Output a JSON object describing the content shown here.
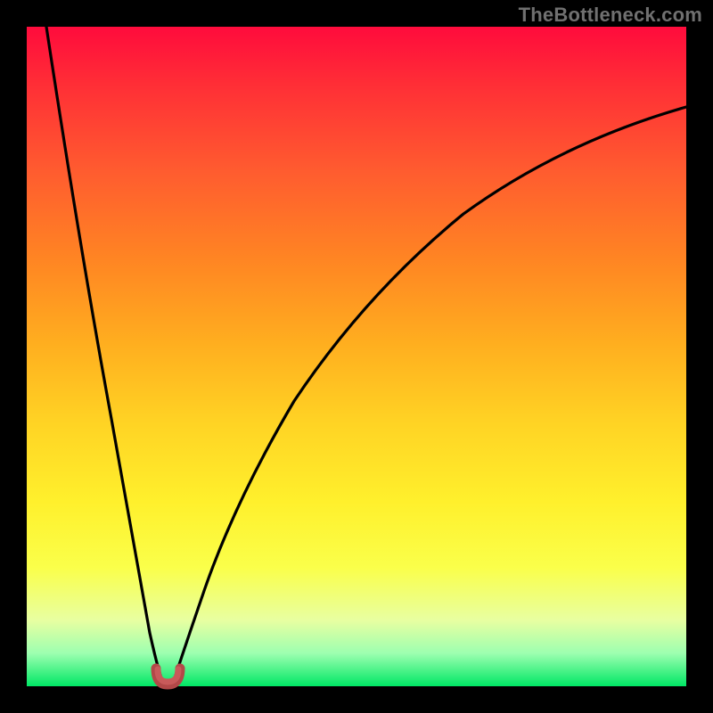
{
  "watermark": "TheBottleneck.com",
  "colors": {
    "page_bg": "#000000",
    "curve_stroke": "#000000",
    "marker_fill": "#c85a5a",
    "marker_stroke": "#b24848",
    "gradient_top": "#ff0b3c",
    "gradient_bottom": "#00e765"
  },
  "chart_data": {
    "type": "line",
    "title": "",
    "xlabel": "",
    "ylabel": "",
    "xlim": [
      0,
      100
    ],
    "ylim": [
      0,
      100
    ],
    "grid": false,
    "legend": false,
    "annotations": [],
    "watermark": "TheBottleneck.com",
    "series": [
      {
        "name": "bottleneck-curve-left",
        "x": [
          3,
          5,
          7,
          9,
          11,
          13,
          15,
          17,
          18,
          19,
          20
        ],
        "values": [
          100,
          85,
          70,
          56,
          42,
          30,
          19,
          10,
          6,
          3,
          1
        ]
      },
      {
        "name": "bottleneck-curve-right",
        "x": [
          22,
          24,
          26,
          29,
          33,
          38,
          44,
          51,
          59,
          68,
          78,
          89,
          100
        ],
        "values": [
          1,
          5,
          11,
          19,
          29,
          39,
          49,
          58,
          66,
          73,
          79,
          84,
          88
        ]
      }
    ],
    "minimum_marker": {
      "x": 21,
      "y": 0.5
    }
  }
}
